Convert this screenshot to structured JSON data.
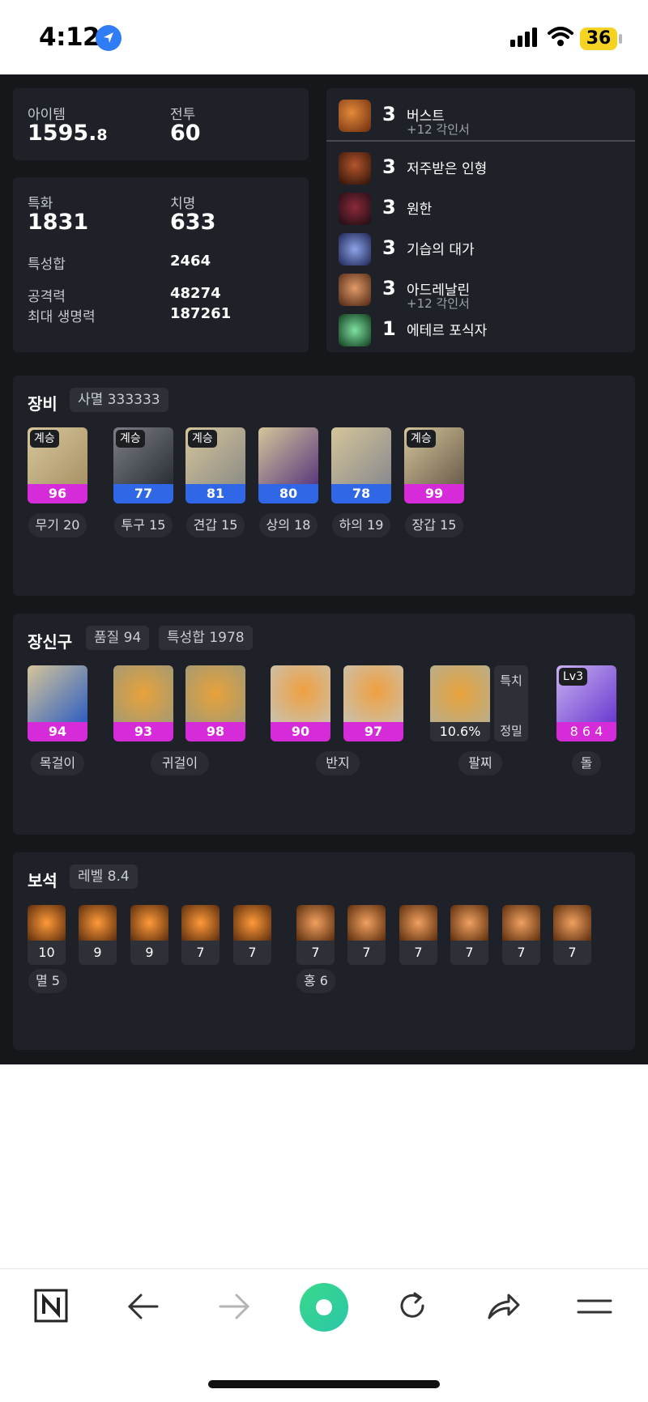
{
  "status_bar": {
    "time": "4:12",
    "battery": "36",
    "icons": [
      "location-arrow-icon",
      "cellular-signal-icon",
      "wifi-icon",
      "battery-icon"
    ]
  },
  "stats": {
    "item_label": "아이템",
    "item_value_main": "1595.",
    "item_value_decimal": "8",
    "combat_label": "전투",
    "combat_value": "60",
    "spec_label": "특화",
    "spec_value": "1831",
    "crit_label": "치명",
    "crit_value": "633",
    "stat_sum_label": "특성합",
    "stat_sum_value": "2464",
    "attack_label": "공격력",
    "attack_value": "48274",
    "hp_label": "최대 생명력",
    "hp_value": "187261"
  },
  "engravings": [
    {
      "level": "3",
      "name": "버스트",
      "sub": "+12 각인서",
      "icon": "burst-engraving-icon",
      "color": "#b5561f"
    },
    {
      "level": "3",
      "name": "저주받은 인형",
      "sub": "",
      "icon": "cursed-doll-engraving-icon",
      "color": "#5a2a1a"
    },
    {
      "level": "3",
      "name": "원한",
      "sub": "",
      "icon": "grudge-engraving-icon",
      "color": "#3b1f2a"
    },
    {
      "level": "3",
      "name": "기습의 대가",
      "sub": "",
      "icon": "master-ambusher-engraving-icon",
      "color": "#2c3a6b"
    },
    {
      "level": "3",
      "name": "아드레날린",
      "sub": "+12 각인서",
      "icon": "adrenaline-engraving-icon",
      "color": "#6b3b20"
    },
    {
      "level": "1",
      "name": "에테르 포식자",
      "sub": "",
      "icon": "ether-predator-engraving-icon",
      "color": "#1f6b3a"
    }
  ],
  "equipment": {
    "title": "장비",
    "set_chip": "사멸 333333",
    "items": [
      {
        "tag": "계승",
        "quality": "96",
        "bar_color": "#d62bd8",
        "label": "무기 20",
        "icon": "weapon-sword-icon"
      },
      {
        "tag": "계승",
        "quality": "77",
        "bar_color": "#2f67e6",
        "label": "투구 15",
        "icon": "helmet-icon"
      },
      {
        "tag": "계승",
        "quality": "81",
        "bar_color": "#2f67e6",
        "label": "견갑 15",
        "icon": "shoulder-armor-icon"
      },
      {
        "tag": "",
        "quality": "80",
        "bar_color": "#2f67e6",
        "label": "상의 18",
        "icon": "chest-armor-icon"
      },
      {
        "tag": "",
        "quality": "78",
        "bar_color": "#2f67e6",
        "label": "하의 19",
        "icon": "leg-armor-icon"
      },
      {
        "tag": "계승",
        "quality": "99",
        "bar_color": "#d62bd8",
        "label": "장갑 15",
        "icon": "gloves-icon"
      }
    ]
  },
  "accessories": {
    "title": "장신구",
    "quality_chip": "품질 94",
    "stat_chip": "특성합 1978",
    "necklace": {
      "quality": "94",
      "icon": "necklace-icon"
    },
    "earrings": [
      {
        "quality": "93",
        "icon": "earring-icon"
      },
      {
        "quality": "98",
        "icon": "earring-icon"
      }
    ],
    "rings": [
      {
        "quality": "90",
        "icon": "ring-icon"
      },
      {
        "quality": "97",
        "icon": "ring-icon"
      }
    ],
    "bracelet": {
      "value": "10.6%",
      "stat1": "특치",
      "stat2": "정밀",
      "icon": "bracelet-icon"
    },
    "stone": {
      "tag": "Lv3",
      "value": "8 6 4",
      "icon": "ability-stone-icon"
    },
    "labels": {
      "necklace": "목걸이",
      "earring": "귀걸이",
      "ring": "반지",
      "bracelet": "팔찌",
      "stone": "돌"
    }
  },
  "gems": {
    "title": "보석",
    "level_chip": "레벨 8.4",
    "annihilation": [
      "10",
      "9",
      "9",
      "7",
      "7"
    ],
    "crimson": [
      "7",
      "7",
      "7",
      "7",
      "7",
      "7"
    ],
    "annihilation_label": "멸 5",
    "crimson_label": "홍 6"
  },
  "browser_nav": {
    "icons": [
      "naver-n-icon",
      "back-arrow-icon",
      "forward-arrow-icon",
      "green-home-button-icon",
      "refresh-icon",
      "share-icon",
      "menu-icon"
    ]
  }
}
